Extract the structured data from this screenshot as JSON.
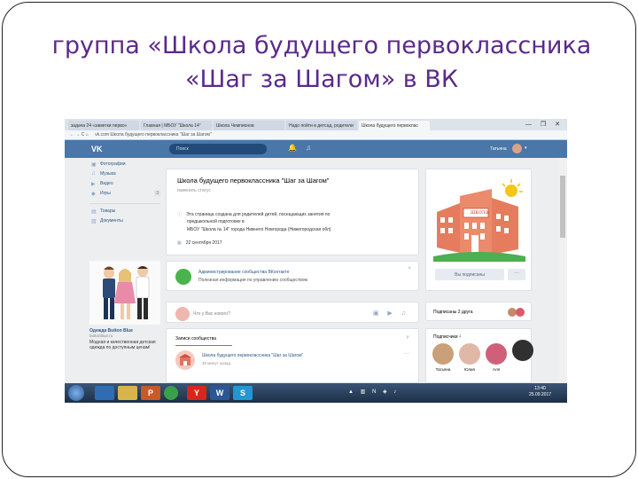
{
  "slide": {
    "title_line1": "группа «Школа будущего первоклассника",
    "title_line2": "«Шаг за Шагом» в ВК"
  },
  "browser": {
    "tabs": [
      {
        "label": "задача 24 «заметки перво»"
      },
      {
        "label": "Главная | МБОУ \"Школа 14\""
      },
      {
        "label": "Школа Чемпионов"
      },
      {
        "label": "Надо пойти в детсад, родители"
      },
      {
        "label": "Школа будущего первоклас"
      }
    ],
    "window_controls": "— ❐ ✕",
    "nav": "← → C ⌂",
    "address": "vk.com  Школа будущего первоклассника \"Шаг за Шагом\""
  },
  "vk_header": {
    "logo": "VK",
    "search_placeholder": "Поиск",
    "bell_icon": "🔔",
    "music_icon": "♫",
    "user_name": "Татьяна",
    "chevron": "▾"
  },
  "sidebar": {
    "items": [
      {
        "icon": "▣",
        "label": "Фотографии"
      },
      {
        "icon": "♫",
        "label": "Музыка"
      },
      {
        "icon": "▶",
        "label": "Видео"
      },
      {
        "icon": "◆",
        "label": "Игры",
        "badge": "3"
      },
      {
        "icon": "▤",
        "label": "Товары"
      },
      {
        "icon": "▥",
        "label": "Документы"
      }
    ]
  },
  "ad": {
    "title": "Одежда Button Blue",
    "subtitle": "buttonblue.ru",
    "text": "Модная и качественная детская одежда по доступным ценам!"
  },
  "group": {
    "name": "Школа будущего первоклассника \"Шаг за Шагом\"",
    "status": "изменить статус",
    "info_icon": "ⓘ",
    "info_line1": "Эта страница создана для родителей детей, посещающих занятия по",
    "info_line2": "предшкольной подготовке в",
    "info_line3": "МБОУ \"Школа № 14\" города Нижнего Новгорода (Нижегородская обл)",
    "date_icon": "▦",
    "date": "22 сентября 2017"
  },
  "notice": {
    "title": "Администрирование сообщества ВКонтакте",
    "text": "Полезная информация по управлению сообществом",
    "close": "×"
  },
  "post_box": {
    "placeholder": "Что у Вас нового?",
    "icons": "▣ ▶ ♫"
  },
  "feed": {
    "tab": "Записи сообщества",
    "search_icon": "⌕",
    "name": "Школа будущего первоклассника \"Шаг за Шагом\"",
    "time": "30 минут назад",
    "more": "···"
  },
  "right": {
    "subscribed": "Вы подписаны",
    "dots": "···",
    "friends": "Подписаны 2 друга",
    "subs_title": "Подписчики",
    "subs_count": "4",
    "subscribers": [
      {
        "name": "Татьяна",
        "color": "#c9a07a"
      },
      {
        "name": "Юлия",
        "color": "#e0b8a8"
      },
      {
        "name": "Аля",
        "color": "#d0607a"
      },
      {
        "name": "",
        "color": "#303030"
      }
    ],
    "school_label": "школа"
  },
  "taskbar": {
    "apps": [
      {
        "label": "",
        "color": "#2e6db3"
      },
      {
        "label": "",
        "color": "#d8b54a"
      },
      {
        "label": "P",
        "color": "#c85a28"
      },
      {
        "label": "",
        "color": "#3aa04a"
      },
      {
        "label": "Y",
        "color": "#d9261c"
      },
      {
        "label": "W",
        "color": "#2b5797"
      },
      {
        "label": "S",
        "color": "#2396d3"
      }
    ],
    "tray": "▲ ▥ N ◈ ♪",
    "time": "13:40",
    "date": "25.09.2017"
  }
}
